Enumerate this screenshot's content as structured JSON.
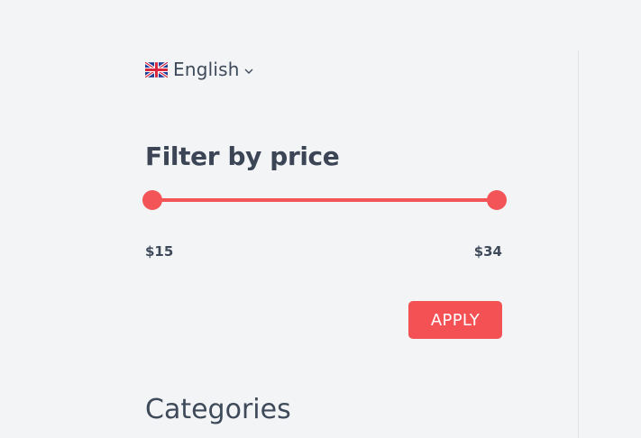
{
  "language": {
    "label": "English",
    "flag_icon": "uk-flag-icon",
    "chevron_icon": "chevron-down-icon"
  },
  "price_filter": {
    "title": "Filter by price",
    "min_label": "$15",
    "max_label": "$34",
    "range_min_fraction": 0,
    "range_max_fraction": 1,
    "accent_color": "#f25457",
    "apply_label": "APPLY"
  },
  "categories": {
    "title": "Categories"
  }
}
